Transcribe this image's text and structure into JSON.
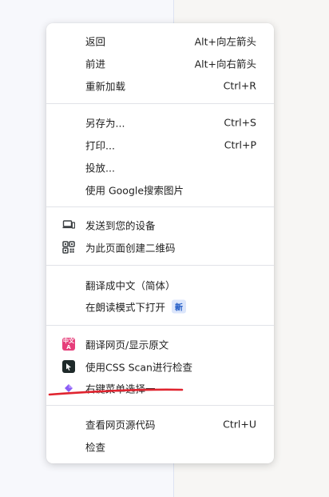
{
  "menu": {
    "back": {
      "label": "返回",
      "shortcut": "Alt+向左箭头"
    },
    "forward": {
      "label": "前进",
      "shortcut": "Alt+向右箭头"
    },
    "reload": {
      "label": "重新加载",
      "shortcut": "Ctrl+R"
    },
    "save_as": {
      "label": "另存为...",
      "shortcut": "Ctrl+S"
    },
    "print": {
      "label": "打印...",
      "shortcut": "Ctrl+P"
    },
    "cast": {
      "label": "投放..."
    },
    "google_image_search": {
      "label": "使用 Google搜索图片"
    },
    "send_to_devices": {
      "label": "发送到您的设备",
      "icon": "devices-icon"
    },
    "qr_code": {
      "label": "为此页面创建二维码",
      "icon": "qr-code-icon"
    },
    "translate": {
      "label": "翻译成中文（简体）"
    },
    "reading_mode": {
      "label": "在朗读模式下打开",
      "badge": "新"
    },
    "translate_ext": {
      "label": "翻译网页/显示原文",
      "icon": "translate-extension-icon",
      "icon_text": "中文A"
    },
    "css_scan": {
      "label": "使用CSS Scan进行检查",
      "icon": "css-scan-icon"
    },
    "custom_ext": {
      "label": "右键菜单选择一",
      "icon": "purple-diamond-icon"
    },
    "view_source": {
      "label": "查看网页源代码",
      "shortcut": "Ctrl+U"
    },
    "inspect": {
      "label": "检查"
    }
  },
  "colors": {
    "annotation_underline": "#e0242f",
    "badge_bg": "#dce6fb",
    "badge_text": "#1a56c4",
    "translate_icon": "#e63e7a",
    "diamond_icon": "#8a5cf5"
  }
}
